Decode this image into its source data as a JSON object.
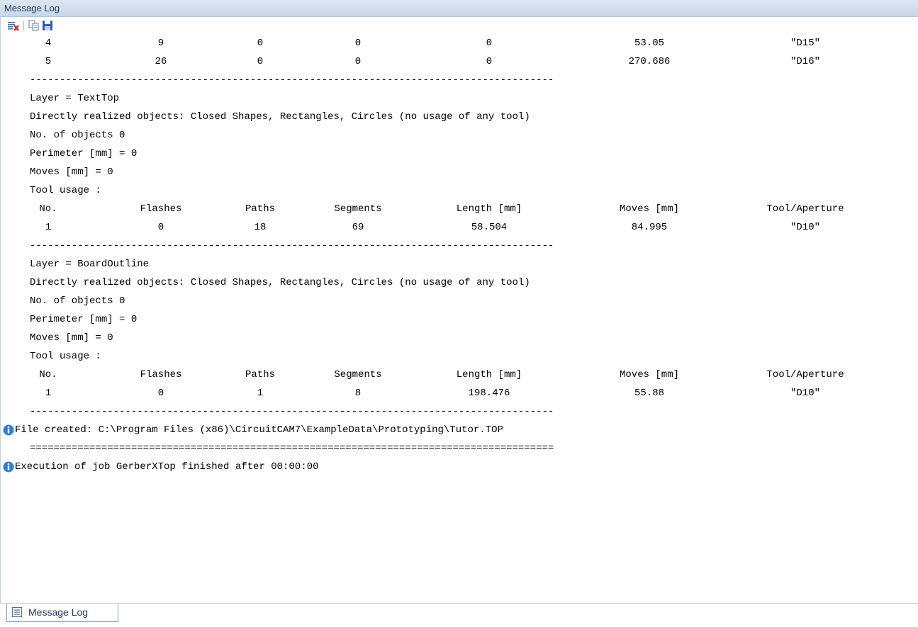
{
  "window": {
    "title": "Message Log"
  },
  "toolbar": {
    "clear_icon": "clear-list-icon",
    "copy_icon": "copy-icon",
    "save_icon": "save-icon"
  },
  "tool_rows_top": [
    {
      "no": "4",
      "flashes": "9",
      "paths": "0",
      "segments": "0",
      "length": "0",
      "moves": "53.05",
      "tool": "\"D15\""
    },
    {
      "no": "5",
      "flashes": "26",
      "paths": "0",
      "segments": "0",
      "length": "0",
      "moves": "270.686",
      "tool": "\"D16\""
    }
  ],
  "separator": "----------------------------------------------------------------------------------------",
  "double_separator": "========================================================================================",
  "layers": [
    {
      "layer": "Layer = TextTop",
      "directly": "Directly realized objects: Closed Shapes, Rectangles, Circles (no usage of any tool)",
      "objects": "No. of objects 0",
      "perimeter": "Perimeter [mm] = 0",
      "moves": "Moves [mm] = 0",
      "tool_usage": "Tool usage :",
      "row": {
        "no": "1",
        "flashes": "0",
        "paths": "18",
        "segments": "69",
        "length": "58.504",
        "moves": "84.995",
        "tool": "\"D10\""
      }
    },
    {
      "layer": "Layer = BoardOutline",
      "directly": "Directly realized objects: Closed Shapes, Rectangles, Circles (no usage of any tool)",
      "objects": "No. of objects 0",
      "perimeter": "Perimeter [mm] = 0",
      "moves": "Moves [mm] = 0",
      "tool_usage": "Tool usage :",
      "row": {
        "no": "1",
        "flashes": "0",
        "paths": "1",
        "segments": "8",
        "length": "198.476",
        "moves": "55.88",
        "tool": "\"D10\""
      }
    }
  ],
  "headers": {
    "no": "No.",
    "flashes": "Flashes",
    "paths": "Paths",
    "segments": "Segments",
    "length": "Length [mm]",
    "moves": "Moves [mm]",
    "tool": "Tool/Aperture"
  },
  "messages": {
    "file_created": "File created: C:\\Program Files (x86)\\CircuitCAM7\\ExampleData\\Prototyping\\Tutor.TOP",
    "execution": "Execution of job GerberXTop finished after 00:00:00"
  },
  "bottom_tab": {
    "label": "Message Log",
    "icon": "log-icon"
  },
  "colors": {
    "info_icon": "#2f7fd8",
    "title_text": "#1e395b"
  }
}
